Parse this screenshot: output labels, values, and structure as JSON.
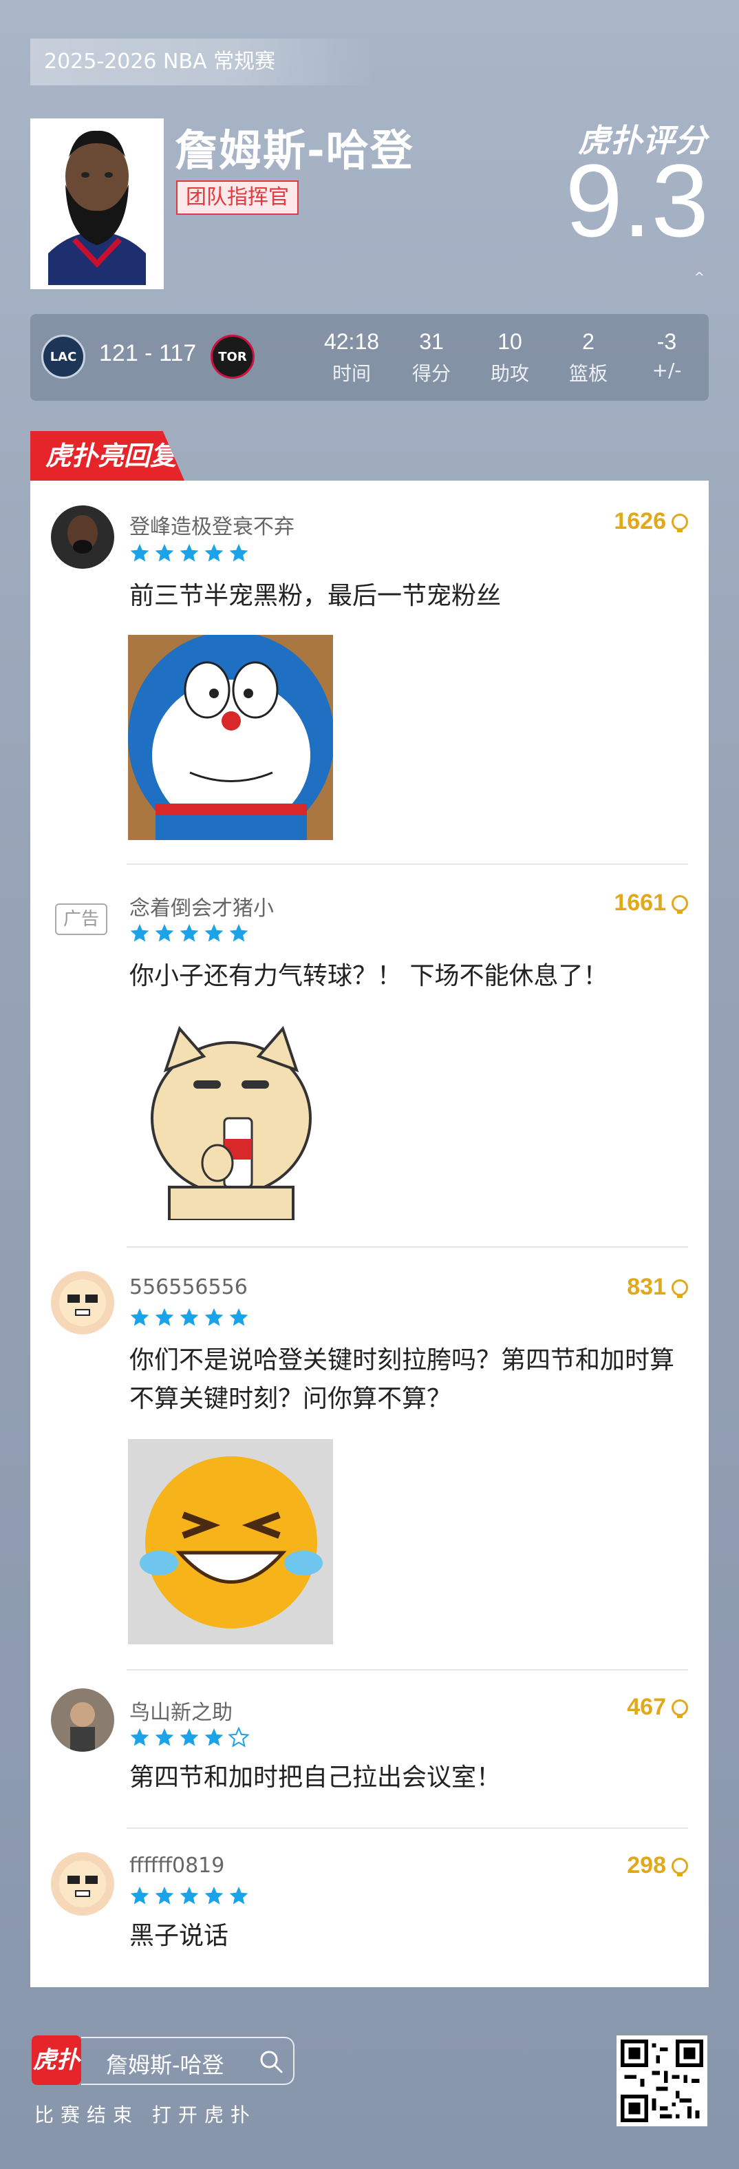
{
  "header": {
    "season": "2025-2026 NBA 常规赛",
    "player_name": "詹姆斯-哈登",
    "player_tag": "团队指挥官",
    "rating_brand": "虎扑评分",
    "rating_score": "9.3",
    "rating_caret": "^"
  },
  "game": {
    "home_team": "LAC",
    "away_team": "TOR",
    "score": "121 - 117",
    "stats": [
      {
        "value": "42:18",
        "label": "时间"
      },
      {
        "value": "31",
        "label": "得分"
      },
      {
        "value": "10",
        "label": "助攻"
      },
      {
        "value": "2",
        "label": "篮板"
      },
      {
        "value": "-3",
        "label": "+/-"
      }
    ]
  },
  "section": {
    "title": "虎扑亮回复"
  },
  "comments": [
    {
      "username": "登峰造极登衰不弃",
      "likes": "1626",
      "stars": 5,
      "text": "前三节半宠黑粉，最后一节宠粉丝",
      "sticker": "doraemon-sticker",
      "ad": false
    },
    {
      "username": "念着倒会才猪小",
      "likes": "1661",
      "stars": 5,
      "text": "你小子还有力气转球？！ 下场不能休息了！",
      "sticker": "shiba-dog-sticker",
      "ad": true,
      "ad_label": "广告"
    },
    {
      "username": "556556556",
      "likes": "831",
      "stars": 5,
      "text": "你们不是说哈登关键时刻拉胯吗？第四节和加时算不算关键时刻？问你算不算？",
      "sticker": "laughing-emoji-sticker",
      "ad": false
    },
    {
      "username": "鸟山新之助",
      "likes": "467",
      "stars": 4,
      "text": "第四节和加时把自己拉出会议室！",
      "ad": false
    },
    {
      "username": "ffffff0819",
      "likes": "298",
      "stars": 5,
      "text": "黑子说话",
      "ad": false
    }
  ],
  "footer": {
    "logo_text": "虎扑",
    "search_text": "詹姆斯-哈登",
    "cta": "比赛结束 打开虎扑"
  },
  "colors": {
    "accent_red": "#e5252a",
    "star_blue": "#1aa3e8",
    "likes_gold": "#e1a81c"
  }
}
